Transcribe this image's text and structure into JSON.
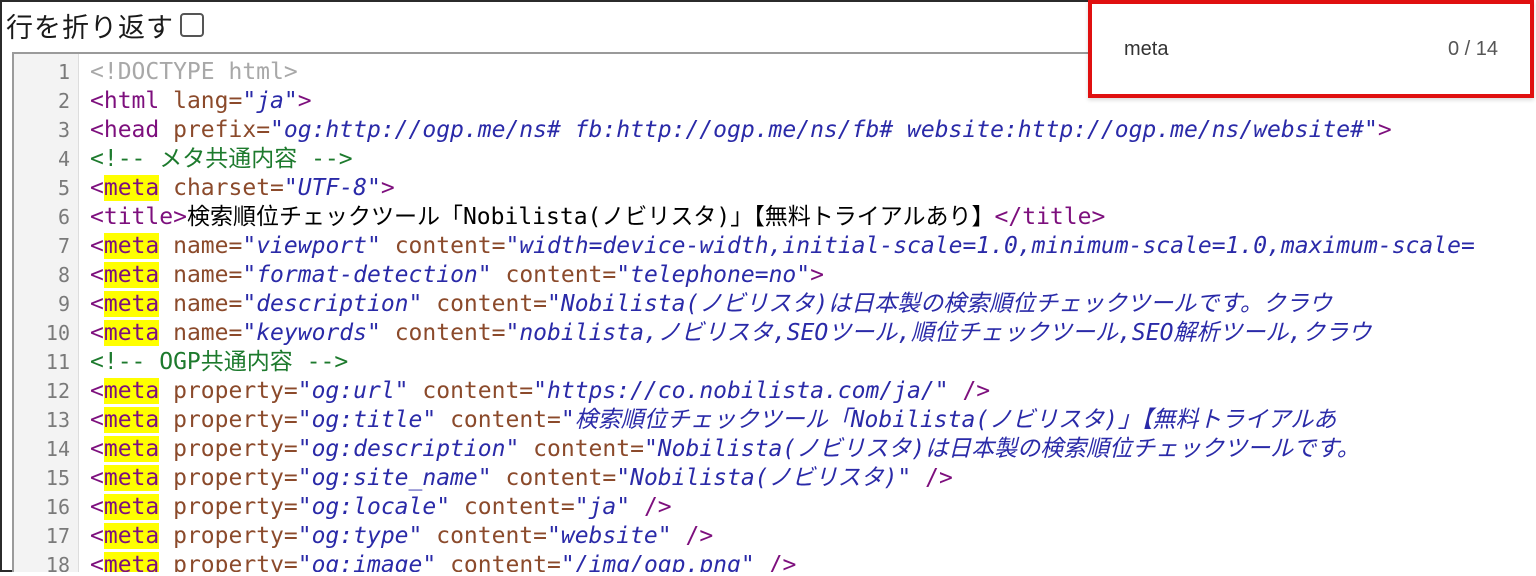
{
  "toolbar": {
    "wrap_label": "行を折り返す"
  },
  "search": {
    "term": "meta",
    "count": "0 / 14"
  },
  "colors": {
    "highlight": "#ffff00",
    "search_border": "#e01010"
  },
  "lines": [
    {
      "n": "1",
      "tokens": [
        [
          "t-doc",
          "<!DOCTYPE html>"
        ]
      ]
    },
    {
      "n": "2",
      "tokens": [
        [
          "t-tag",
          "<html"
        ],
        [
          "t-txt",
          " "
        ],
        [
          "t-attr",
          "lang="
        ],
        [
          "t-str",
          "\"ja\""
        ],
        [
          "t-tag",
          ">"
        ]
      ]
    },
    {
      "n": "3",
      "tokens": [
        [
          "t-tag",
          "<head"
        ],
        [
          "t-txt",
          " "
        ],
        [
          "t-attr",
          "prefix="
        ],
        [
          "t-str",
          "\"og:http://ogp.me/ns# fb:http://ogp.me/ns/fb# website:http://ogp.me/ns/website#\""
        ],
        [
          "t-tag",
          ">"
        ]
      ]
    },
    {
      "n": "4",
      "tokens": [
        [
          "t-com",
          "<!-- メタ共通内容 -->"
        ]
      ]
    },
    {
      "n": "5",
      "tokens": [
        [
          "t-tag",
          "<"
        ],
        [
          "hl",
          "meta"
        ],
        [
          "t-txt",
          " "
        ],
        [
          "t-attr",
          "charset="
        ],
        [
          "t-str",
          "\"UTF-8\""
        ],
        [
          "t-tag",
          ">"
        ]
      ]
    },
    {
      "n": "6",
      "tokens": [
        [
          "t-tag",
          "<title>"
        ],
        [
          "t-txt",
          "検索順位チェックツール「Nobilista(ノビリスタ)」【無料トライアルあり】"
        ],
        [
          "t-tag",
          "</title>"
        ]
      ]
    },
    {
      "n": "7",
      "tokens": [
        [
          "t-tag",
          "<"
        ],
        [
          "hl",
          "meta"
        ],
        [
          "t-txt",
          " "
        ],
        [
          "t-attr",
          "name="
        ],
        [
          "t-str",
          "\"viewport\""
        ],
        [
          "t-txt",
          " "
        ],
        [
          "t-attr",
          "content="
        ],
        [
          "t-str",
          "\"width=device-width,initial-scale=1.0,minimum-scale=1.0,maximum-scale="
        ]
      ]
    },
    {
      "n": "8",
      "tokens": [
        [
          "t-tag",
          "<"
        ],
        [
          "hl",
          "meta"
        ],
        [
          "t-txt",
          " "
        ],
        [
          "t-attr",
          "name="
        ],
        [
          "t-str",
          "\"format-detection\""
        ],
        [
          "t-txt",
          " "
        ],
        [
          "t-attr",
          "content="
        ],
        [
          "t-str",
          "\"telephone=no\""
        ],
        [
          "t-tag",
          ">"
        ]
      ]
    },
    {
      "n": "9",
      "tokens": [
        [
          "t-tag",
          "<"
        ],
        [
          "hl",
          "meta"
        ],
        [
          "t-txt",
          " "
        ],
        [
          "t-attr",
          "name="
        ],
        [
          "t-str",
          "\"description\""
        ],
        [
          "t-txt",
          " "
        ],
        [
          "t-attr",
          "content="
        ],
        [
          "t-str",
          "\"Nobilista(ノビリスタ)は日本製の検索順位チェックツールです。クラウ"
        ]
      ]
    },
    {
      "n": "10",
      "tokens": [
        [
          "t-tag",
          "<"
        ],
        [
          "hl",
          "meta"
        ],
        [
          "t-txt",
          " "
        ],
        [
          "t-attr",
          "name="
        ],
        [
          "t-str",
          "\"keywords\""
        ],
        [
          "t-txt",
          " "
        ],
        [
          "t-attr",
          "content="
        ],
        [
          "t-str",
          "\"nobilista,ノビリスタ,SEOツール,順位チェックツール,SEO解析ツール,クラウ"
        ]
      ]
    },
    {
      "n": "11",
      "tokens": [
        [
          "t-com",
          "<!-- OGP共通内容 -->"
        ]
      ]
    },
    {
      "n": "12",
      "tokens": [
        [
          "t-tag",
          "<"
        ],
        [
          "hl",
          "meta"
        ],
        [
          "t-txt",
          " "
        ],
        [
          "t-attr",
          "property="
        ],
        [
          "t-str",
          "\"og:url\""
        ],
        [
          "t-txt",
          " "
        ],
        [
          "t-attr",
          "content="
        ],
        [
          "t-str",
          "\"https://co.nobilista.com/ja/\""
        ],
        [
          "t-txt",
          " "
        ],
        [
          "t-tag",
          "/>"
        ]
      ]
    },
    {
      "n": "13",
      "tokens": [
        [
          "t-tag",
          "<"
        ],
        [
          "hl",
          "meta"
        ],
        [
          "t-txt",
          " "
        ],
        [
          "t-attr",
          "property="
        ],
        [
          "t-str",
          "\"og:title\""
        ],
        [
          "t-txt",
          " "
        ],
        [
          "t-attr",
          "content="
        ],
        [
          "t-str",
          "\"検索順位チェックツール「Nobilista(ノビリスタ)」【無料トライアルあ"
        ]
      ]
    },
    {
      "n": "14",
      "tokens": [
        [
          "t-tag",
          "<"
        ],
        [
          "hl",
          "meta"
        ],
        [
          "t-txt",
          " "
        ],
        [
          "t-attr",
          "property="
        ],
        [
          "t-str",
          "\"og:description\""
        ],
        [
          "t-txt",
          " "
        ],
        [
          "t-attr",
          "content="
        ],
        [
          "t-str",
          "\"Nobilista(ノビリスタ)は日本製の検索順位チェックツールです。"
        ]
      ]
    },
    {
      "n": "15",
      "tokens": [
        [
          "t-tag",
          "<"
        ],
        [
          "hl",
          "meta"
        ],
        [
          "t-txt",
          " "
        ],
        [
          "t-attr",
          "property="
        ],
        [
          "t-str",
          "\"og:site_name\""
        ],
        [
          "t-txt",
          " "
        ],
        [
          "t-attr",
          "content="
        ],
        [
          "t-str",
          "\"Nobilista(ノビリスタ)\""
        ],
        [
          "t-txt",
          " "
        ],
        [
          "t-tag",
          "/>"
        ]
      ]
    },
    {
      "n": "16",
      "tokens": [
        [
          "t-tag",
          "<"
        ],
        [
          "hl",
          "meta"
        ],
        [
          "t-txt",
          " "
        ],
        [
          "t-attr",
          "property="
        ],
        [
          "t-str",
          "\"og:locale\""
        ],
        [
          "t-txt",
          " "
        ],
        [
          "t-attr",
          "content="
        ],
        [
          "t-str",
          "\"ja\""
        ],
        [
          "t-txt",
          " "
        ],
        [
          "t-tag",
          "/>"
        ]
      ]
    },
    {
      "n": "17",
      "tokens": [
        [
          "t-tag",
          "<"
        ],
        [
          "hl",
          "meta"
        ],
        [
          "t-txt",
          " "
        ],
        [
          "t-attr",
          "property="
        ],
        [
          "t-str",
          "\"og:type\""
        ],
        [
          "t-txt",
          " "
        ],
        [
          "t-attr",
          "content="
        ],
        [
          "t-str",
          "\"website\""
        ],
        [
          "t-txt",
          " "
        ],
        [
          "t-tag",
          "/>"
        ]
      ]
    },
    {
      "n": "18",
      "tokens": [
        [
          "t-tag",
          "<"
        ],
        [
          "hl",
          "meta"
        ],
        [
          "t-txt",
          " "
        ],
        [
          "t-attr",
          "property="
        ],
        [
          "t-str",
          "\"og:image\""
        ],
        [
          "t-txt",
          " "
        ],
        [
          "t-attr",
          "content="
        ],
        [
          "t-str",
          "\"/img/ogp.png\""
        ],
        [
          "t-txt",
          " "
        ],
        [
          "t-tag",
          "/>"
        ]
      ]
    }
  ]
}
